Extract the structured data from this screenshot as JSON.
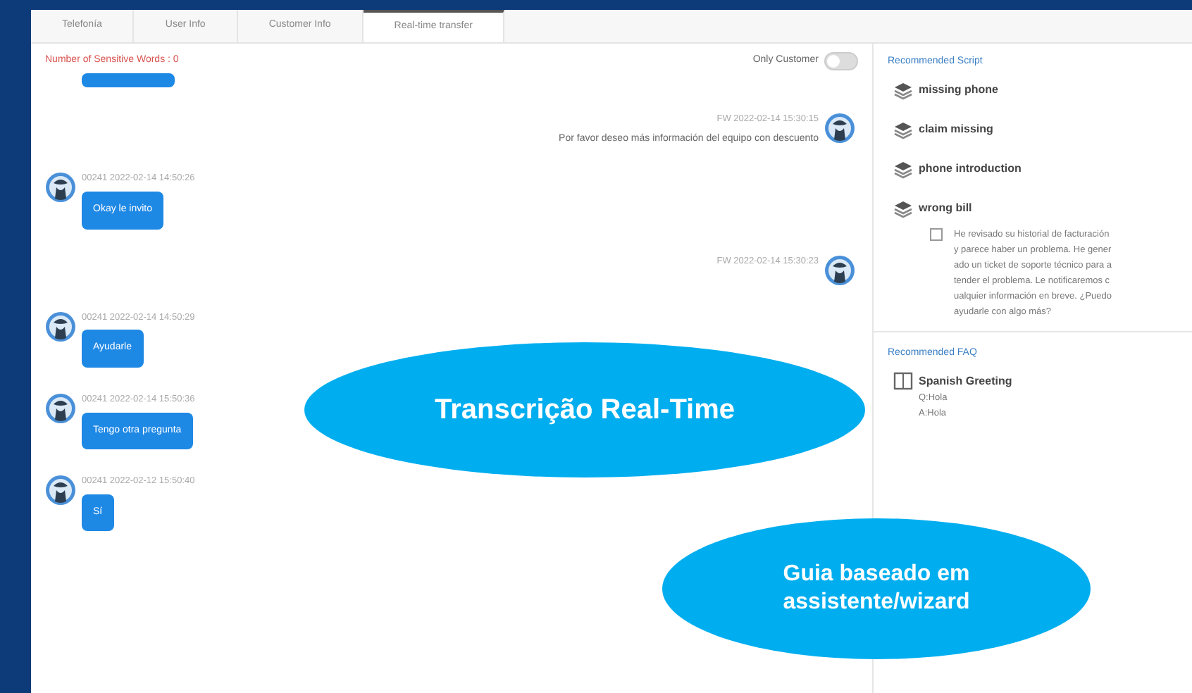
{
  "tabs": [
    {
      "label": "Telefonía",
      "selected": false
    },
    {
      "label": "User Info",
      "selected": false
    },
    {
      "label": "Customer Info",
      "selected": false
    },
    {
      "label": "Real-time transfer",
      "selected": true
    }
  ],
  "chat": {
    "sensitive_words": "Number of Sensitive Words : 0",
    "only_customer": {
      "label": "Only Customer",
      "on": false
    },
    "messages": [
      {
        "kind": "partial"
      },
      {
        "kind": "outgoing",
        "sender": "FW",
        "time": "2022-02-14 15:30:15",
        "text": "Por favor deseo más información del equipo con descuento"
      },
      {
        "kind": "incoming",
        "sender": "00241",
        "time": "2022-02-14 14:50:26",
        "text": "Okay le invito"
      },
      {
        "kind": "outgoing",
        "sender": "FW",
        "time": "2022-02-14 15:30:23"
      },
      {
        "kind": "incoming",
        "sender": "00241",
        "time": "2022-02-14 14:50:29",
        "text": "Ayudarle"
      },
      {
        "kind": "incoming",
        "sender": "00241",
        "time": "2022-02-14 15:50:36",
        "text": "Tengo otra pregunta"
      },
      {
        "kind": "incoming",
        "sender": "00241",
        "time": "2022-02-12 15:50:40",
        "text": "Sí"
      }
    ]
  },
  "script": {
    "title": "Recommended Script",
    "items": [
      {
        "label": "missing phone"
      },
      {
        "label": "claim missing"
      },
      {
        "label": "phone introduction"
      },
      {
        "label": "wrong bill",
        "checked": false,
        "lines": [
          "He revisado su historial de facturación",
          "y parece haber un problema. He gener",
          "ado un ticket de soporte técnico para a",
          "tender el problema. Le notificaremos c",
          "ualquier información en breve. ¿Puedo",
          "ayudarle con algo más?"
        ]
      }
    ]
  },
  "faq": {
    "title": "Recommended FAQ",
    "items": [
      {
        "title": "Spanish Greeting",
        "question": "Q:Hola",
        "answer": "A:Hola"
      }
    ]
  },
  "callouts": [
    {
      "text": "Transcrição Real-Time",
      "kind": "large"
    },
    {
      "text": "Guia baseado em assistente/wizard",
      "kind": "small"
    }
  ]
}
